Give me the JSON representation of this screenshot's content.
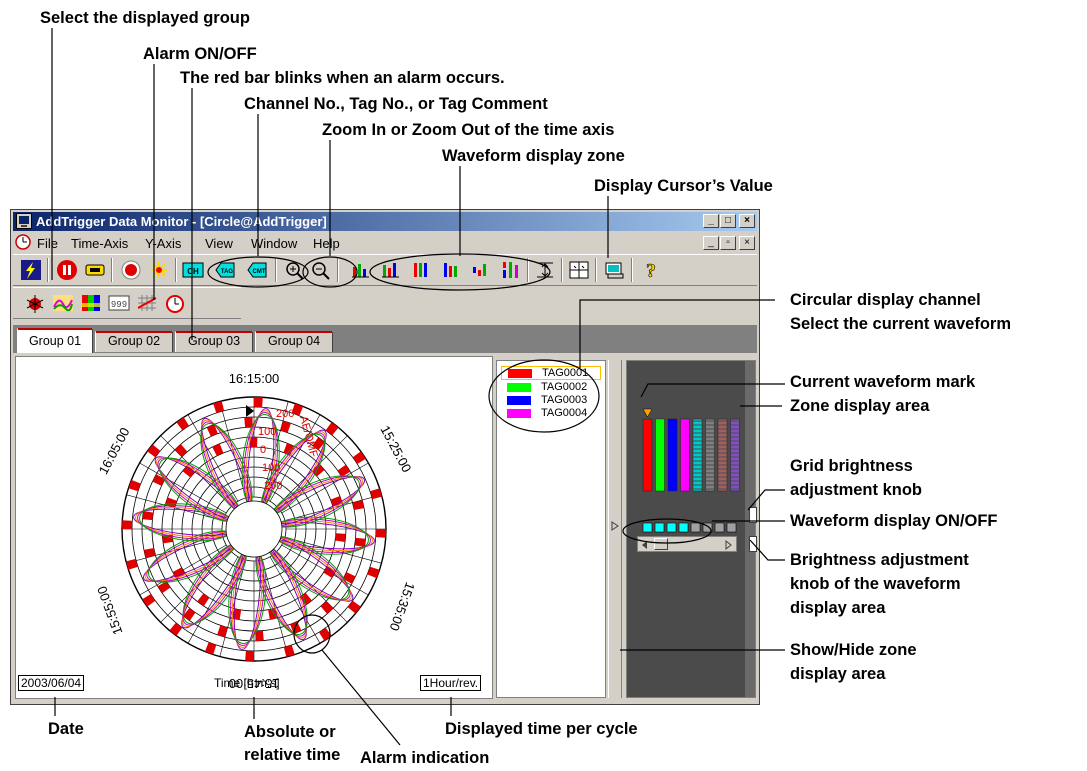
{
  "annotations": {
    "select_group": "Select the displayed group",
    "alarm_onoff": "Alarm ON/OFF",
    "red_bar": "The red bar blinks when an alarm occurs.",
    "channel_tag": "Channel No., Tag No., or Tag Comment",
    "zoom": "Zoom In or Zoom Out of the time axis",
    "waveform_zone": "Waveform display zone",
    "cursor_value": "Display Cursor’s Value",
    "circular_channel": "Circular display channel",
    "select_current": "Select the current waveform",
    "current_mark": "Current waveform mark",
    "zone_area": "Zone display area",
    "grid_brightness_1": "Grid brightness",
    "grid_brightness_2": "adjustment knob",
    "waveform_onoff": "Waveform display ON/OFF",
    "brightness_1": "Brightness adjustment",
    "brightness_2": "knob of the waveform",
    "brightness_3": "display area",
    "showhide_1": "Show/Hide zone",
    "showhide_2": "display area",
    "date": "Date",
    "abs_rel_1": "Absolute or",
    "abs_rel_2": "relative time",
    "time_per_cycle": "Displayed time per cycle",
    "alarm_indication": "Alarm indication"
  },
  "window": {
    "title": "AddTrigger Data Monitor - [Circle@AddTrigger]",
    "menu": [
      "File",
      "Time-Axis",
      "Y-Axis",
      "View",
      "Window",
      "Help"
    ]
  },
  "toolbar": {
    "ch_button": "CH",
    "tag_button": "TAG",
    "comment_button": "CMT",
    "counter_button": "999"
  },
  "tabs": [
    "Group 01",
    "Group 02",
    "Group 03",
    "Group 04"
  ],
  "active_tab": 0,
  "plot": {
    "time_top": "16:15:00",
    "time_right_upper": "15:25:00",
    "time_right_lower": "15:35:00",
    "time_bottom": "15:45:00",
    "time_left_lower": "15:55:00",
    "time_left_upper": "16:05:00",
    "date": "2003/06/04",
    "time_label": "Time [h:m:s]",
    "cycle": "1Hour/rev.",
    "scale_top": "200",
    "scale_labels": [
      "100",
      "0",
      "100",
      "200"
    ],
    "scale_unit": "AE/OMF"
  },
  "legend": [
    {
      "name": "TAG0001",
      "color": "#ff0000"
    },
    {
      "name": "TAG0002",
      "color": "#00ff00"
    },
    {
      "name": "TAG0003",
      "color": "#0000ff"
    },
    {
      "name": "TAG0004",
      "color": "#ff00ff"
    }
  ],
  "zone_bars": [
    "#ff0000",
    "#00ff00",
    "#0000ff",
    "#ff00ff",
    "#00c8c8",
    "#808080",
    "#a06060",
    "#8050c0"
  ],
  "waveform_toggle": [
    {
      "color": "#00ffff",
      "on": true
    },
    {
      "color": "#00ffff",
      "on": true
    },
    {
      "color": "#00ffff",
      "on": true
    },
    {
      "color": "#00ffff",
      "on": true
    },
    {
      "color": "#a0a0a0",
      "on": false
    },
    {
      "color": "#a0a0a0",
      "on": false
    },
    {
      "color": "#a0a0a0",
      "on": false
    },
    {
      "color": "#a0a0a0",
      "on": false
    }
  ]
}
